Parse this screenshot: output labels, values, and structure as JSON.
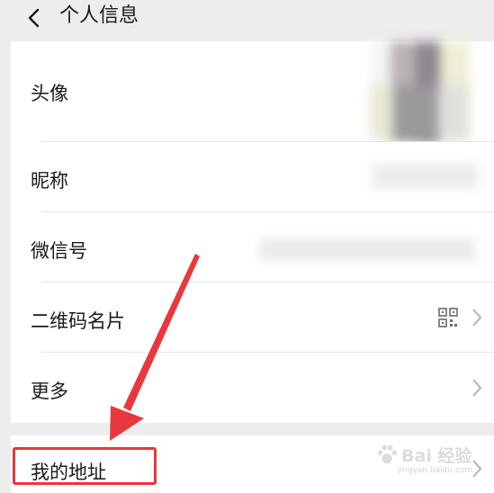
{
  "header": {
    "back_icon": "chevron-left-icon",
    "title": "个人信息"
  },
  "rows": [
    {
      "label": "头像",
      "value_type": "avatar-image-blurred"
    },
    {
      "label": "昵称",
      "value_type": "text-blurred"
    },
    {
      "label": "微信号",
      "value_type": "text-blurred"
    },
    {
      "label": "二维码名片",
      "right_icon": "qr-code-icon"
    },
    {
      "label": "更多"
    },
    {
      "label": "我的地址"
    }
  ],
  "annotation": {
    "arrow_color": "#e8383d",
    "highlight_color": "#e8383d"
  },
  "watermark": {
    "main": "Bai 经验",
    "sub": "jingyan.baidu.com"
  },
  "colors": {
    "background": "#ededed",
    "row_background": "#ffffff",
    "text": "#1a1a1a",
    "chevron": "#b2b2b2"
  }
}
